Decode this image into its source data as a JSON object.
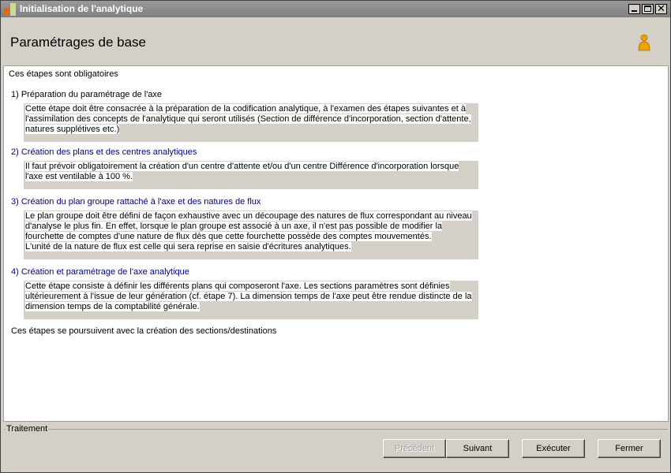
{
  "window": {
    "title": "Initialisation de l'analytique"
  },
  "header": {
    "title": "Paramétrages de base"
  },
  "content": {
    "intro": "Ces étapes sont obligatoires",
    "steps": [
      {
        "title": "1) Préparation du paramétrage de l'axe",
        "lines": [
          "Cette étape doit être consacrée à la préparation de la codification analytique, à l'examen des étapes suivantes et à",
          "l'assimilation des concepts de l'analytique qui seront utilisés (Section de différence d'incorporation, section d'attente,",
          "natures supplétives etc.)"
        ]
      },
      {
        "title": "2) Création des plans et des centres analytiques",
        "lines": [
          "Il faut prévoir obligatoirement la création d'un centre d'attente et/ou d'un centre Différence d'incorporation lorsque",
          "l'axe est ventilable à 100 %."
        ]
      },
      {
        "title": "3) Création du plan groupe rattaché à l'axe et des natures de flux",
        "lines": [
          "Le plan groupe doit être défini de façon exhaustive avec un découpage des natures de flux correspondant au niveau",
          "d'analyse le plus fin. En effet, lorsque le plan groupe est associé à un axe, il n'est pas possible de modifier la",
          "fourchette de comptes d'une nature de flux dès que cette fourchette possède des comptes mouvementés.",
          "L'unité de la nature de flux est celle qui sera reprise en saisie d'écritures analytiques."
        ]
      },
      {
        "title": "4) Création et paramétrage de l'axe analytique",
        "lines": [
          "Cette étape consiste à définir les différents plans qui composeront l'axe. Les sections paramètres sont définies",
          "ultérieurement à l'issue de leur génération (cf. étape 7). La dimension temps de l'axe peut être rendue distincte de la",
          "dimension temps de la comptabilité générale."
        ]
      }
    ],
    "outro": "Ces étapes se poursuivent avec la création des sections/destinations"
  },
  "footer": {
    "group_label": "Traitement",
    "buttons": {
      "previous": "Précédent",
      "next": "Suivant",
      "execute": "Exécuter",
      "close": "Fermer"
    }
  },
  "colors": {
    "titlebar": "#8a8a8a",
    "face": "#d4d0c8",
    "link_blue": "#000080",
    "user_icon": "#f0a000"
  },
  "icons": [
    "app-icon",
    "minimize-icon",
    "maximize-icon",
    "close-icon",
    "user-icon"
  ]
}
